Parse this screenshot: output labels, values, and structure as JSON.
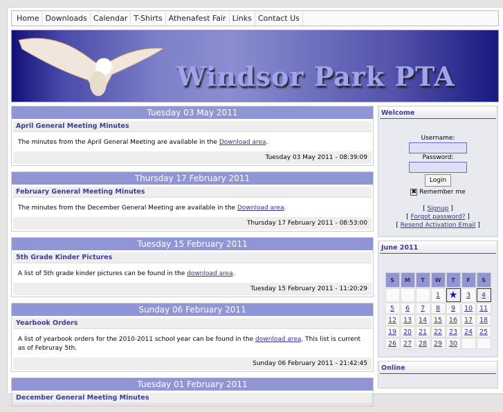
{
  "nav": [
    "Home",
    "Downloads",
    "Calendar",
    "T-Shirts",
    "Athenafest Fair",
    "Links",
    "Contact Us"
  ],
  "banner": {
    "title": "Windsor Park PTA"
  },
  "news": [
    {
      "date": "Tuesday 03 May 2011",
      "title": "April General Meeting Minutes",
      "body_pre": "The minutes from the April General Meeting are available in the ",
      "link": "Download area",
      "body_post": ".",
      "posted": "Tuesday 03 May 2011 - 08:39:09"
    },
    {
      "date": "Thursday 17 February 2011",
      "title": "February General Meeting Minutes",
      "body_pre": "The minutes from the December General Meeting are available in the ",
      "link": "Download area",
      "body_post": ".",
      "posted": "Thursday 17 February 2011 - 08:53:00"
    },
    {
      "date": "Tuesday 15 February 2011",
      "title": "5th Grade Kinder Pictures",
      "body_pre": "A list of 5th grade kinder pictures can be found in the ",
      "link": "download area",
      "body_post": ".",
      "posted": "Tuesday 15 February 2011 - 11:20:29"
    },
    {
      "date": "Sunday 06 February 2011",
      "title": "Yearbook Orders",
      "body_pre": "A list of yearbook orders for the 2010-2011 school year can be found in the ",
      "link": "download area",
      "body_post": ". This list is current as of Februray 5th.",
      "posted": "Sunday 06 February 2011 - 21:42:45"
    },
    {
      "date": "Tuesday 01 February 2011",
      "title": "December General Meeting Minutes"
    }
  ],
  "welcome": {
    "heading": "Welcome",
    "username_label": "Username:",
    "password_label": "Password:",
    "login": "Login",
    "remember": "Remember me",
    "signup": "Signup",
    "forgot": "Forgot password?",
    "resend": "Resend Activation Email"
  },
  "calendar": {
    "heading": "June 2011",
    "days": [
      "S",
      "M",
      "T",
      "W",
      "T",
      "F",
      "S"
    ],
    "weeks": [
      [
        "",
        "",
        "",
        "1",
        "★",
        "3",
        "4"
      ],
      [
        "5",
        "6",
        "7",
        "8",
        "9",
        "10",
        "11"
      ],
      [
        "12",
        "13",
        "14",
        "15",
        "16",
        "17",
        "18"
      ],
      [
        "19",
        "20",
        "21",
        "22",
        "23",
        "24",
        "25"
      ],
      [
        "26",
        "27",
        "28",
        "29",
        "30",
        "",
        ""
      ]
    ]
  },
  "online": {
    "heading": "Online"
  }
}
